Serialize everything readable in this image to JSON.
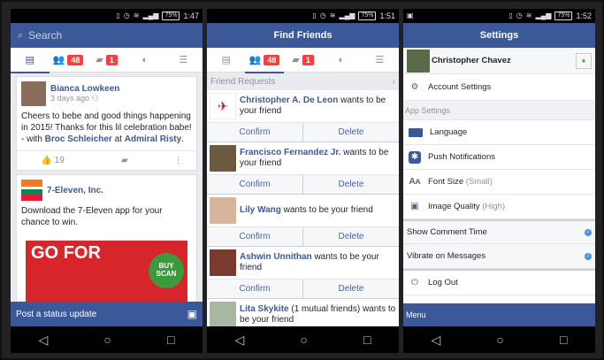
{
  "s1": {
    "status_time": "1:47",
    "battery": "75%",
    "search_placeholder": "Search",
    "friends_badge": "48",
    "messages_badge": "1",
    "post1": {
      "author": "Bianca Lowkeen",
      "time": "3 days ago",
      "text_a": "Cheers to bebe and good things happening in 2015! Thanks for this lil celebration babe! - with ",
      "tag1": "Broc Schleicher",
      "text_b": " at ",
      "tag2": "Admiral Risty",
      "text_c": ".",
      "likes": "19"
    },
    "post2": {
      "author": "7-Eleven, Inc.",
      "text": "Download the 7-Eleven app for your chance to win.",
      "promo_big": "GO FOR",
      "promo_bubble": "BUY SCAN"
    },
    "status_update": "Post a status update"
  },
  "s2": {
    "status_time": "1:51",
    "battery": "75%",
    "title": "Find Friends",
    "friends_badge": "48",
    "messages_badge": "1",
    "section": "Friend Requests",
    "requests": [
      {
        "name": "Christopher A. De Leon",
        "rest": " wants to be your friend",
        "confirm": "Confirm",
        "delete": "Delete"
      },
      {
        "name": "Francisco Fernandez Jr.",
        "rest": " wants to be your friend",
        "confirm": "Confirm",
        "delete": "Delete"
      },
      {
        "name": "Lily Wang",
        "rest": " wants to be your friend",
        "confirm": "Confirm",
        "delete": "Delete"
      },
      {
        "name": "Ashwin Unnithan",
        "rest": " wants to be your friend",
        "confirm": "Confirm",
        "delete": "Delete"
      },
      {
        "name": "Lita Skykite",
        "rest": " (1 mutual friends) wants to be your friend",
        "confirm": "",
        "delete": ""
      }
    ]
  },
  "s3": {
    "status_time": "1:52",
    "battery": "75%",
    "title": "Settings",
    "profile_name": "Christopher Chavez",
    "account_settings": "Account Settings",
    "app_settings": "App Settings",
    "language": "Language",
    "push": "Push Notifications",
    "font_size": "Font Size",
    "font_size_value": "(Small)",
    "image_quality": "Image Quality",
    "image_quality_value": "(High)",
    "show_comment_time": "Show Comment Time",
    "vibrate": "Vibrate on Messages",
    "logout": "Log Out",
    "menu": "Menu"
  },
  "colors": {
    "brand": "#3b5998",
    "badge": "#fa3e3e",
    "background": "#e9ebee"
  }
}
